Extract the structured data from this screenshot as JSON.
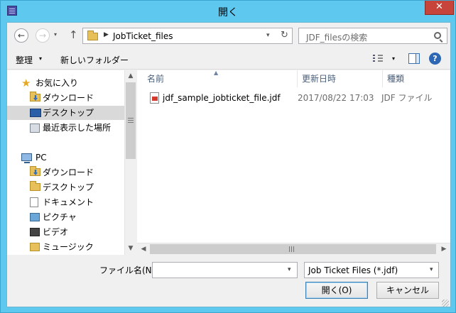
{
  "window": {
    "title": "開く",
    "close_label": "✕"
  },
  "nav": {
    "back": "←",
    "forward": "→",
    "up": "↑",
    "dropdown": "▾"
  },
  "address": {
    "separator": "▶",
    "path": "JobTicket_files",
    "refresh": "↻"
  },
  "search": {
    "placeholder": "JDF_filesの検索"
  },
  "toolbar": {
    "organize": "整理",
    "new_folder": "新しいフォルダー",
    "help": "?"
  },
  "sidebar": {
    "favorites": {
      "label": "お気に入り",
      "items": [
        {
          "label": "ダウンロード",
          "icon": "download-folder-icon"
        },
        {
          "label": "デスクトップ",
          "icon": "desktop-icon",
          "selected": true
        },
        {
          "label": "最近表示した場所",
          "icon": "recent-places-icon"
        }
      ]
    },
    "pc": {
      "label": "PC",
      "items": [
        {
          "label": "ダウンロード",
          "icon": "download-folder-icon"
        },
        {
          "label": "デスクトップ",
          "icon": "desktop-icon"
        },
        {
          "label": "ドキュメント",
          "icon": "documents-icon"
        },
        {
          "label": "ピクチャ",
          "icon": "pictures-icon"
        },
        {
          "label": "ビデオ",
          "icon": "videos-icon"
        },
        {
          "label": "ミュージック",
          "icon": "music-icon"
        }
      ]
    }
  },
  "columns": {
    "name": "名前",
    "date": "更新日時",
    "type": "種類"
  },
  "files": [
    {
      "name": "jdf_sample_jobticket_file.jdf",
      "date": "2017/08/22 17:03",
      "type": "JDF ファイル"
    }
  ],
  "bottom": {
    "filename_label": "ファイル名(N):",
    "filename_value": "",
    "filetype_value": "Job Ticket Files (*.jdf)",
    "open_label": "開く(O)",
    "cancel_label": "キャンセル"
  },
  "colors": {
    "titlebar": "#5fc8ef",
    "close": "#c7443a"
  }
}
